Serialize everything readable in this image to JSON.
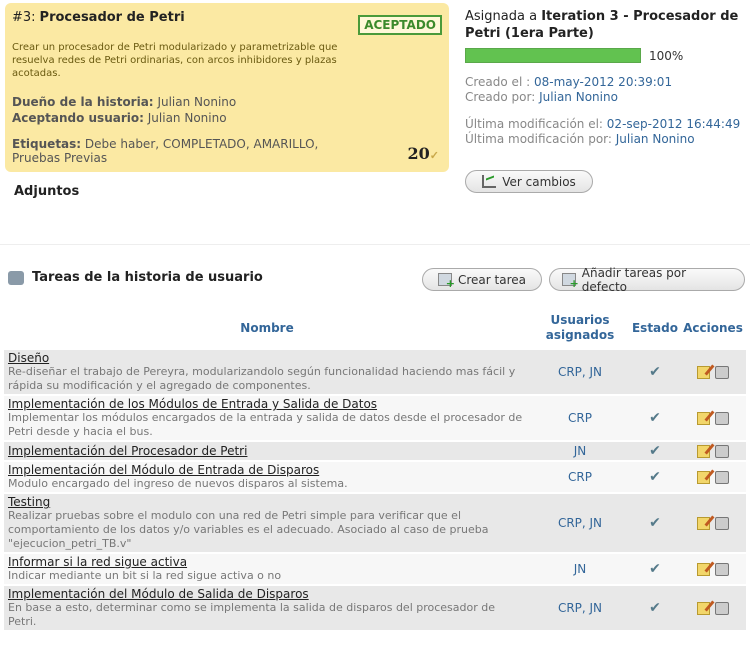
{
  "story": {
    "number": "#3:",
    "title": "Procesador de Petri",
    "status": "ACEPTADO",
    "description": "Crear un procesador de Petri modularizado y parametrizable que resuelva redes de Petri ordinarias, con arcos inhibidores y plazas acotadas.",
    "owner_label": "Dueño de la historia:",
    "owner": "Julian Nonino",
    "acceptor_label": "Aceptando usuario:",
    "acceptor": "Julian Nonino",
    "tags_label": "Etiquetas:",
    "tags": "Debe haber, COMPLETADO, AMARILLO, Pruebas Previas",
    "points": "20",
    "attachments_label": "Adjuntos"
  },
  "sprint": {
    "assigned_label": "Asignada a",
    "iteration": "Iteration 3 - Procesador de Petri (1era Parte)",
    "progress": 100,
    "progress_text": "100%"
  },
  "dates": {
    "created_label": "Creado el :",
    "created": "08-may-2012 20:39:01",
    "created_by_label": "Creado por:",
    "created_by": "Julian Nonino",
    "modified_label": "Última modificación el:",
    "modified": "02-sep-2012 16:44:49",
    "modified_by_label": "Última modificación por:",
    "modified_by": "Julian Nonino"
  },
  "buttons": {
    "changes": "Ver cambios",
    "create_task": "Crear tarea",
    "add_default": "Añadir tareas por defecto"
  },
  "tasks": {
    "heading": "Tareas de la historia de usuario",
    "columns": {
      "name": "Nombre",
      "users": "Usuarios asignados",
      "state": "Estado",
      "actions": "Acciones"
    },
    "rows": [
      {
        "name": "Diseño",
        "desc": "Re-diseñar el trabajo de Pereyra, modularizandolo según funcionalidad haciendo mas fácil y rápida su modificación y el agregado de componentes.",
        "users": "CRP, JN"
      },
      {
        "name": "Implementación de los Módulos de Entrada y Salida de Datos",
        "desc": "Implementar los módulos encargados de la entrada y salida de datos desde el procesador de Petri desde y hacia el bus.",
        "users": "CRP"
      },
      {
        "name": "Implementación del Procesador de Petri",
        "desc": "",
        "users": "JN"
      },
      {
        "name": "Implementación del Módulo de Entrada de Disparos",
        "desc": "Modulo encargado del ingreso de nuevos disparos al sistema.",
        "users": "CRP"
      },
      {
        "name": "Testing",
        "desc": "Realizar pruebas sobre el modulo con una red de Petri simple para verificar que el comportamiento de los datos y/o variables es el adecuado. Asociado al caso de prueba \"ejecucion_petri_TB.v\"",
        "users": "CRP, JN"
      },
      {
        "name": "Informar si la red sigue activa",
        "desc": "Indicar mediante un bit si la red sigue activa o no",
        "users": "JN"
      },
      {
        "name": "Implementación del Módulo de Salida de Disparos",
        "desc": "En base a esto, determinar como se implementa la salida de disparos del procesador de Petri.",
        "users": "CRP, JN"
      }
    ]
  }
}
